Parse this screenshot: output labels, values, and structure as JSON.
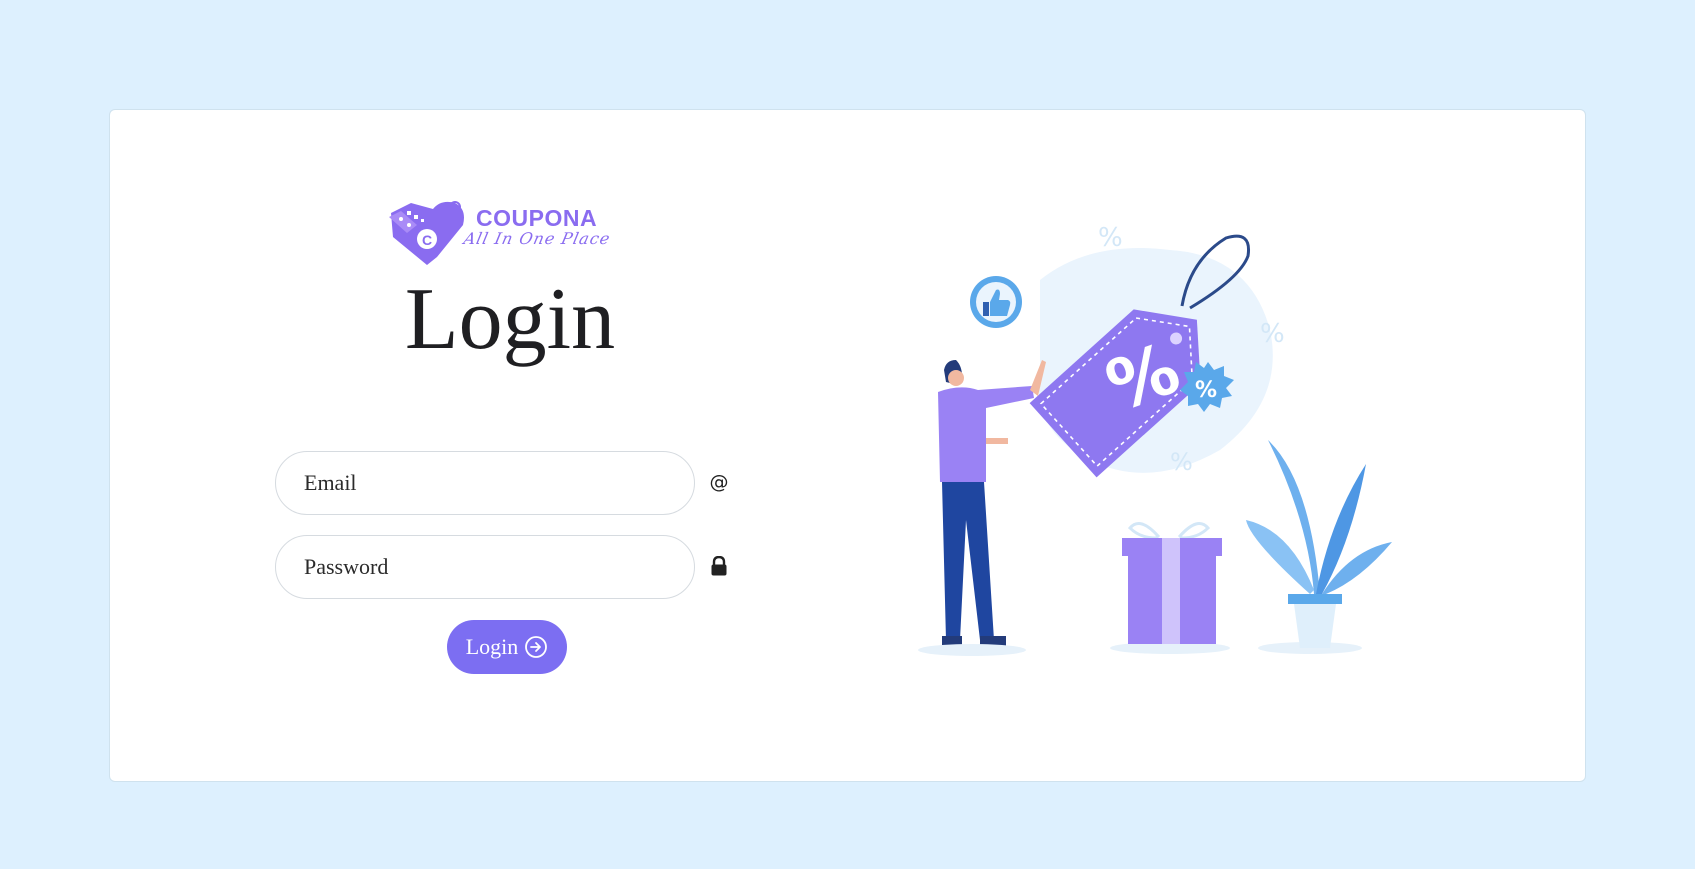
{
  "brand": {
    "name": "COUPONA",
    "tagline": "All In One Place",
    "logo_letter": "C"
  },
  "login": {
    "title": "Login",
    "email_placeholder": "Email",
    "password_placeholder": "Password",
    "submit_label": "Login"
  },
  "illustration": {
    "tag_symbol": "%",
    "badge_symbol": "%"
  },
  "colors": {
    "page_bg": "#ddf0fe",
    "card_bg": "#ffffff",
    "accent": "#7c6ef2",
    "brand_purple": "#8a6cf0"
  },
  "icons": {
    "email": "at-icon",
    "password": "lock-icon",
    "submit": "arrow-circle-right-icon"
  }
}
